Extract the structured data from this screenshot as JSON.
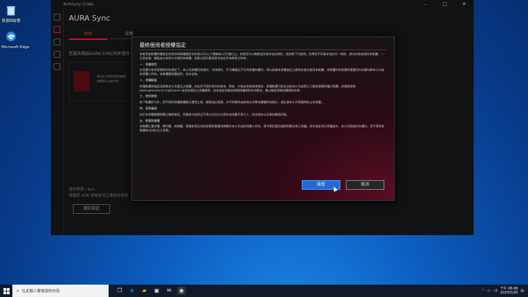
{
  "desktop": {
    "icons": [
      {
        "label": "資源回收筒",
        "name": "recycle-bin-icon"
      },
      {
        "label": "Microsoft Edge",
        "name": "edge-icon"
      }
    ]
  },
  "app": {
    "window_title": "Armoury Crate",
    "header": "AURA Sync",
    "tabs": [
      "同步",
      "設備"
    ],
    "bg_text": "您還未開啟AURA SYNC同步燈效",
    "device_name_line1": "ROG CROSSHAIR",
    "device_name_line2": "HERO (WI-FI)",
    "bottom_label": "燈效預覽 / Ruo",
    "bottom_desc": "請確認 HUE 燈條是否已連接至系統",
    "save_label": "儲存設定"
  },
  "dialog": {
    "title": "最終使用者授權協定",
    "intro": "本使用者軟體授權協定為您與華碩電腦股份有限公司(以下簡稱本公司)間訂立。為使您可以瞭解並同意本協定條款，請詳閱下列說明。如果您不同意本協定任一條款，請勿安裝或使用本軟體。一旦您安裝、複製或以其他方式使用本軟體，即表示您同意接受本協定所有條款之約束。",
    "sections": [
      {
        "heading": "一、授權使用",
        "text": "在您遵守本同意條款所有規定下，本公司授權您有限的、非排他的、不可轉讓及不可再授權的權利，得以依據本授權協定之條款安裝及使用本軟體。本軟體所有智慧財產權及所有權均歸本公司或其授權人所有，本軟體僅授權使用，並非出售。"
      },
      {
        "heading": "二、授權範圍",
        "text": "授權軟體為製造及販售本公司產品之軟體，包括但不限於其所有版本、更新、升級或其他修改版本。授權軟體可能包含依本公司或第三人開放源碼授權之軟體，詳情請參閱 www.opensource.org/license 或其他適用之授權條款，若本協定與開放源碼授權條款有所衝突，應以開放源碼授權條款為準。"
      },
      {
        "heading": "三、使用限制",
        "text": "除了軟體許可外，您不得對授權軟體進行還原工程、解譯或反組譯，亦不得移除或修改任何專有權聲明或標示，違反者本公司得隨時終止本授權。"
      },
      {
        "heading": "四、保密義務",
        "text": "對於本授權軟體相關之機密資訊，您應保守秘密且不得以任何方式提供或洩露予第三人，除非經本公司事前書面同意。"
      },
      {
        "heading": "五、智慧財產權",
        "text": "本軟體之著作權、專利權、商標權、營業秘密及其他智慧財產權均歸屬於本公司或其授權人所有，受中華民國及國際相關法律之保護。除本協定明示授權者外，本公司保留所有權利，您不得對本軟體為任何形式之侵害。"
      }
    ],
    "accept_label": "接受",
    "cancel_label": "取消"
  },
  "taskbar": {
    "search_placeholder": "在此輸入要搜尋的內容",
    "time": "下午 08:48",
    "date": "2020/5/26"
  },
  "colors": {
    "accent": "#c0192b",
    "primary_button": "#1f6ad8"
  }
}
